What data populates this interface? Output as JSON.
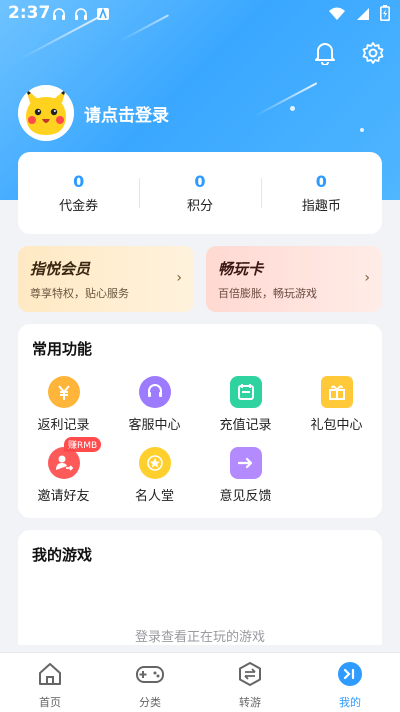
{
  "status_bar": {
    "time": "2:37"
  },
  "profile": {
    "login_prompt": "请点击登录"
  },
  "stats": [
    {
      "value": "0",
      "label": "代金券"
    },
    {
      "value": "0",
      "label": "积分"
    },
    {
      "value": "0",
      "label": "指趣币"
    }
  ],
  "promos": {
    "vip": {
      "title": "指悦会员",
      "subtitle": "尊享特权，贴心服务",
      "arrow": "›"
    },
    "play": {
      "title": "畅玩卡",
      "subtitle": "百倍膨胀，畅玩游戏",
      "arrow": "›"
    }
  },
  "functions": {
    "title": "常用功能",
    "items": [
      {
        "label": "返利记录",
        "icon": "rebate-icon"
      },
      {
        "label": "客服中心",
        "icon": "customer-service-icon"
      },
      {
        "label": "充值记录",
        "icon": "recharge-icon"
      },
      {
        "label": "礼包中心",
        "icon": "gift-icon"
      },
      {
        "label": "邀请好友",
        "icon": "invite-icon",
        "badge": "赚RMB"
      },
      {
        "label": "名人堂",
        "icon": "hall-of-fame-icon"
      },
      {
        "label": "意见反馈",
        "icon": "feedback-icon"
      }
    ]
  },
  "games": {
    "title": "我的游戏",
    "empty_text": "登录查看正在玩的游戏"
  },
  "tabs": [
    {
      "label": "首页",
      "icon": "home-icon"
    },
    {
      "label": "分类",
      "icon": "gamepad-icon"
    },
    {
      "label": "转游",
      "icon": "transfer-icon"
    },
    {
      "label": "我的",
      "icon": "profile-icon",
      "active": true
    }
  ],
  "colors": {
    "accent": "#2f9bff",
    "hero": "#3aa7ff"
  }
}
